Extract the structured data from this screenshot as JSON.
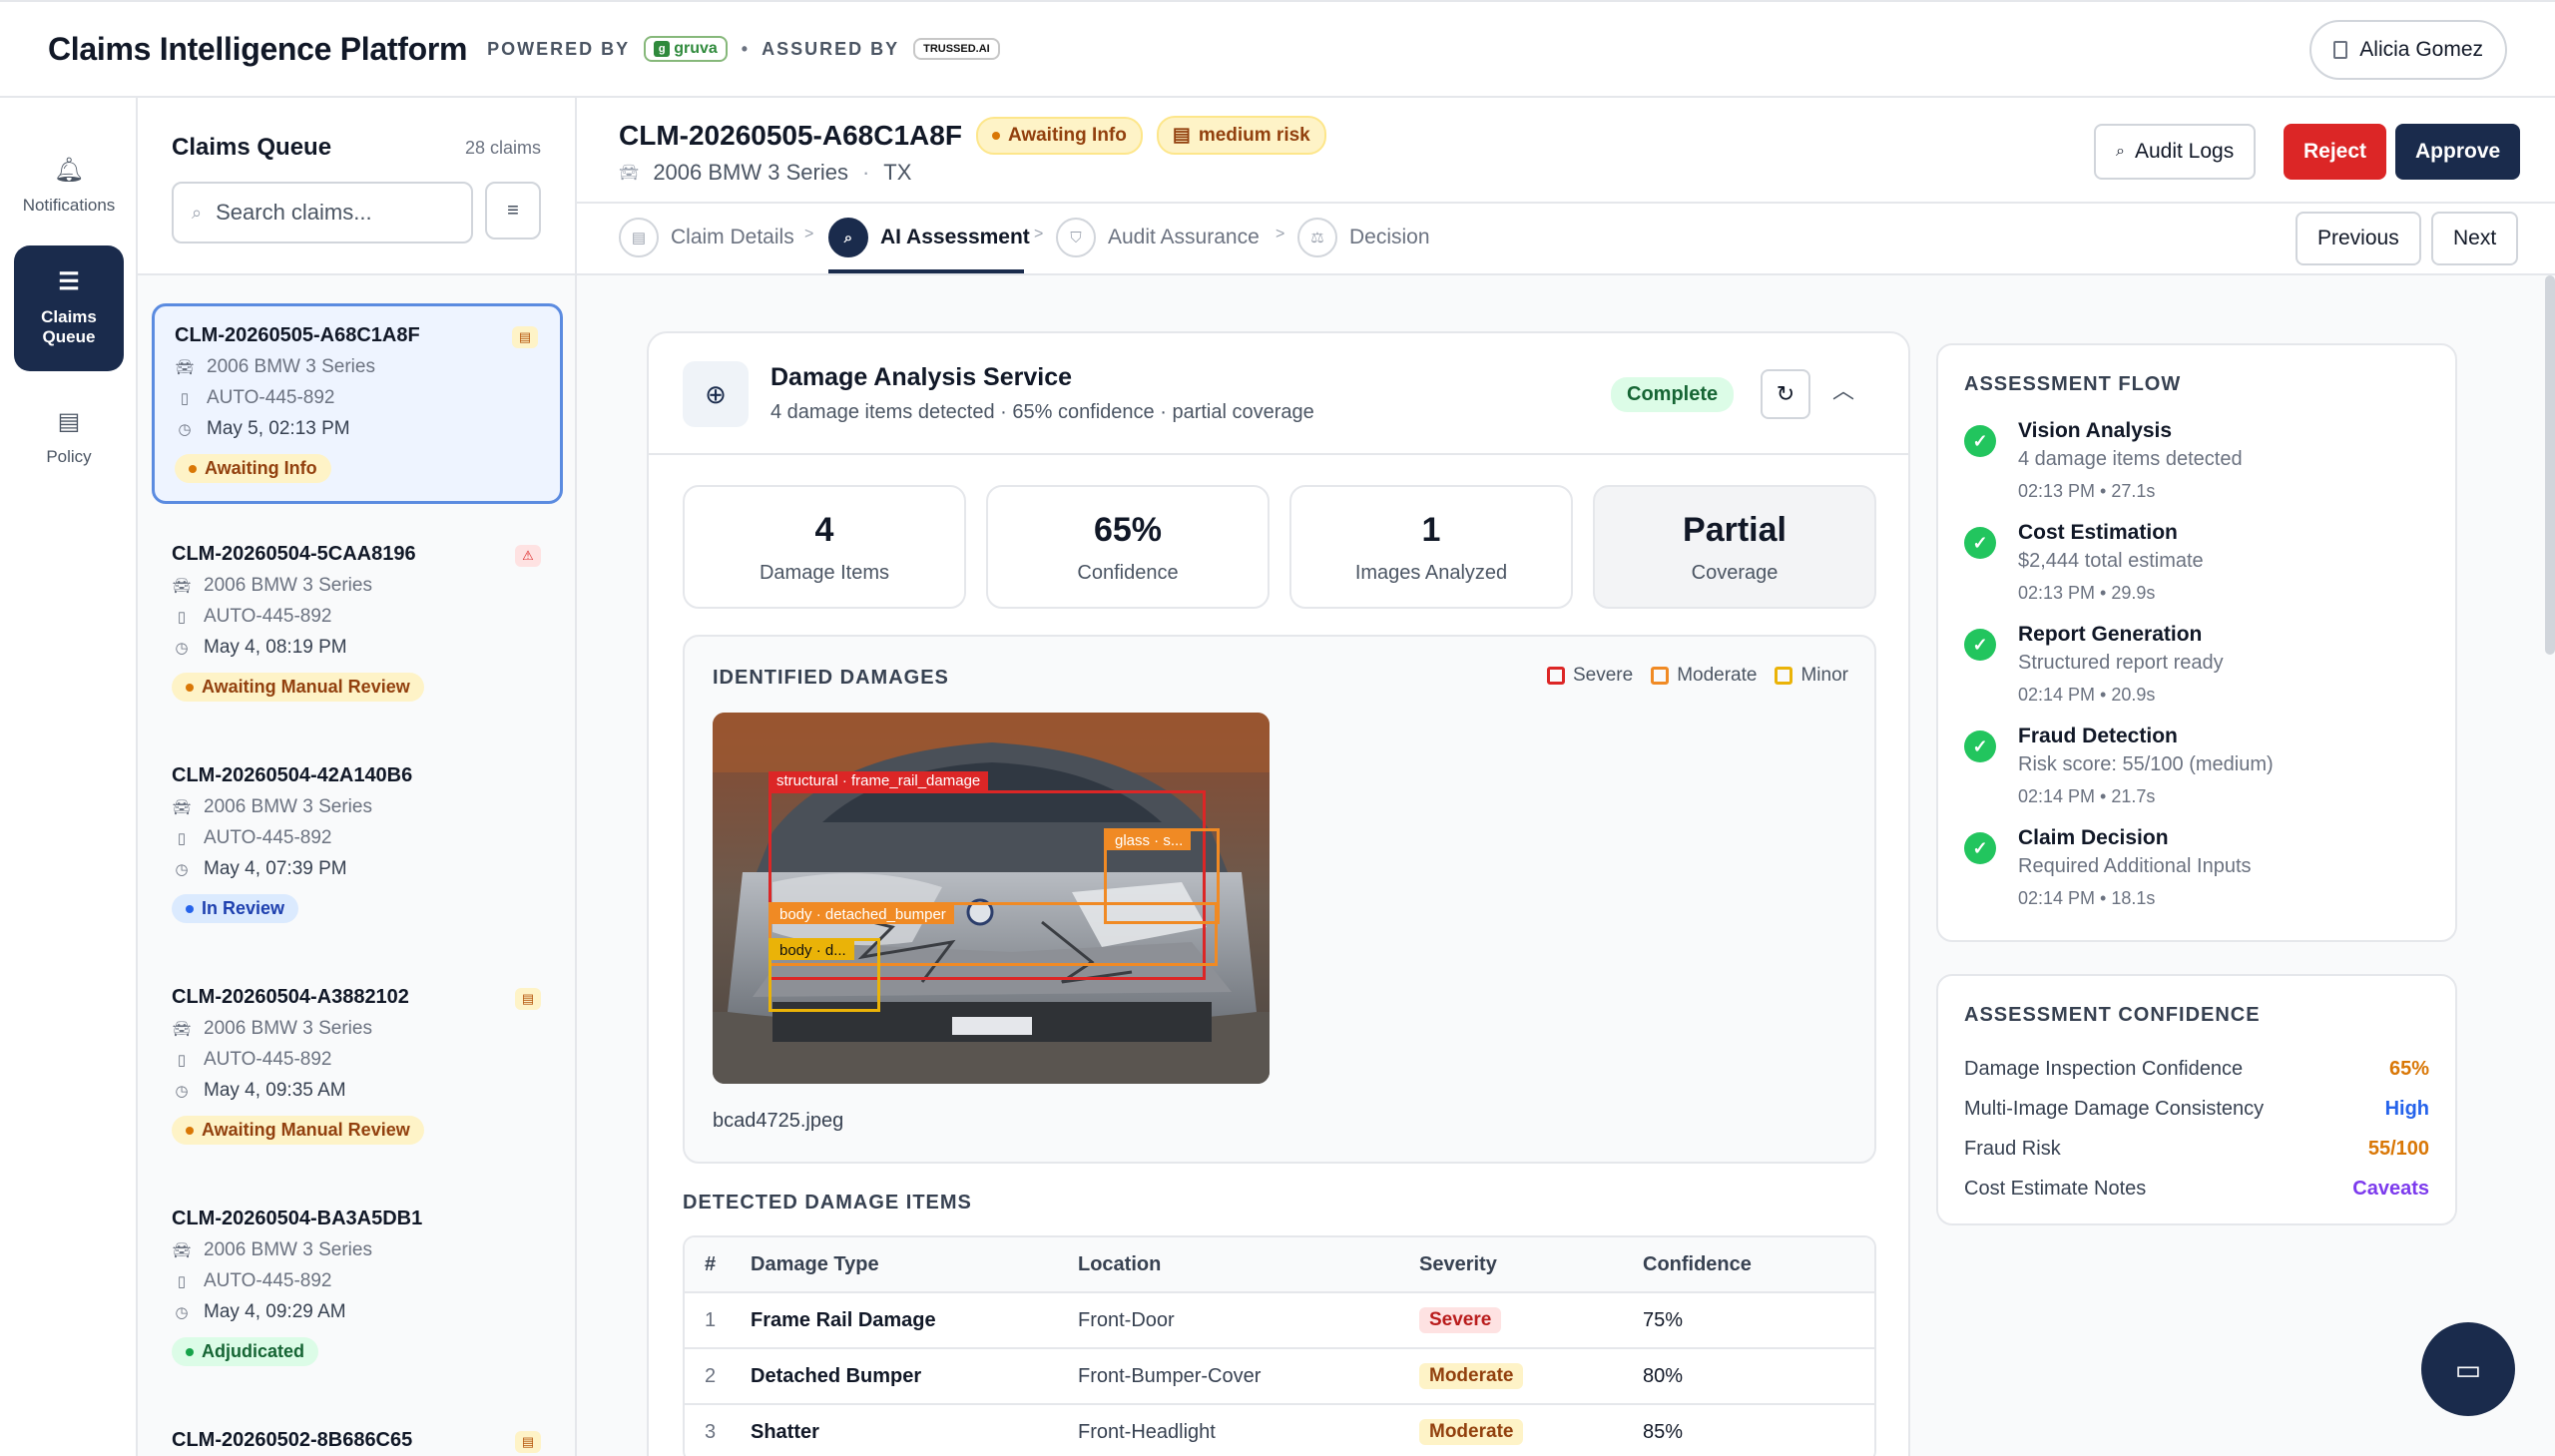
{
  "app": {
    "title": "Claims Intelligence Platform",
    "powered_by": "POWERED BY",
    "gruva": "gruva",
    "dot": "•",
    "assured_by": "ASSURED BY",
    "trussed": "TRUSSED.AI",
    "user_name": "Alicia Gomez"
  },
  "nav": {
    "notifications": "Notifications",
    "claims_queue": "Claims Queue",
    "policy": "Policy"
  },
  "queue": {
    "title": "Claims Queue",
    "count": "28 claims",
    "search_placeholder": "Search claims...",
    "claims": [
      {
        "id": "CLM-20260505-A68C1A8F",
        "vehicle": "2006 BMW 3 Series",
        "policy": "AUTO-445-892",
        "date": "May 5, 02:13 PM",
        "status": "Awaiting Info",
        "flag": "document"
      },
      {
        "id": "CLM-20260504-5CAA8196",
        "vehicle": "2006 BMW 3 Series",
        "policy": "AUTO-445-892",
        "date": "May 4, 08:19 PM",
        "status": "Awaiting Manual Review",
        "flag": "alert"
      },
      {
        "id": "CLM-20260504-42A140B6",
        "vehicle": "2006 BMW 3 Series",
        "policy": "AUTO-445-892",
        "date": "May 4, 07:39 PM",
        "status": "In Review",
        "flag": ""
      },
      {
        "id": "CLM-20260504-A3882102",
        "vehicle": "2006 BMW 3 Series",
        "policy": "AUTO-445-892",
        "date": "May 4, 09:35 AM",
        "status": "Awaiting Manual Review",
        "flag": "document"
      },
      {
        "id": "CLM-20260504-BA3A5DB1",
        "vehicle": "2006 BMW 3 Series",
        "policy": "AUTO-445-892",
        "date": "May 4, 09:29 AM",
        "status": "Adjudicated",
        "flag": ""
      },
      {
        "id": "CLM-20260502-8B686C65",
        "vehicle": "",
        "policy": "",
        "date": "",
        "status": "",
        "flag": "document"
      }
    ]
  },
  "claim": {
    "id": "CLM-20260505-A68C1A8F",
    "status": "Awaiting Info",
    "risk": "medium risk",
    "vehicle": "2006 BMW 3 Series",
    "sep": "·",
    "state": "TX",
    "audit_logs": "Audit Logs",
    "reject": "Reject",
    "approve": "Approve",
    "previous": "Previous",
    "next": "Next",
    "steps": [
      "Claim Details",
      "AI Assessment",
      "Audit Assurance",
      "Decision"
    ]
  },
  "service": {
    "title": "Damage Analysis Service",
    "subtitle": "4 damage items detected · 65% confidence · partial coverage",
    "status": "Complete",
    "stats": [
      {
        "value": "4",
        "label": "Damage Items"
      },
      {
        "value": "65%",
        "label": "Confidence"
      },
      {
        "value": "1",
        "label": "Images Analyzed"
      },
      {
        "value": "Partial",
        "label": "Coverage"
      }
    ],
    "identified_label": "IDENTIFIED DAMAGES",
    "legend": [
      "Severe",
      "Moderate",
      "Minor"
    ],
    "boxes": [
      {
        "label": "structural · frame_rail_damage",
        "severity": "severe"
      },
      {
        "label": "glass · s...",
        "severity": "moderate"
      },
      {
        "label": "body · detached_bumper",
        "severity": "moderate"
      },
      {
        "label": "body · d...",
        "severity": "minor"
      }
    ],
    "filename": "bcad4725.jpeg",
    "detected_label": "DETECTED DAMAGE ITEMS",
    "table_headers": [
      "#",
      "Damage Type",
      "Location",
      "Severity",
      "Confidence"
    ],
    "rows": [
      {
        "n": "1",
        "type": "Frame Rail Damage",
        "location": "Front-Door",
        "severity": "Severe",
        "confidence": "75%"
      },
      {
        "n": "2",
        "type": "Detached Bumper",
        "location": "Front-Bumper-Cover",
        "severity": "Moderate",
        "confidence": "80%"
      },
      {
        "n": "3",
        "type": "Shatter",
        "location": "Front-Headlight",
        "severity": "Moderate",
        "confidence": "85%"
      }
    ]
  },
  "flow": {
    "title": "ASSESSMENT FLOW",
    "items": [
      {
        "title": "Vision Analysis",
        "desc": "4 damage items detected",
        "meta": "02:13 PM • 27.1s"
      },
      {
        "title": "Cost Estimation",
        "desc": "$2,444 total estimate",
        "meta": "02:13 PM • 29.9s"
      },
      {
        "title": "Report Generation",
        "desc": "Structured report ready",
        "meta": "02:14 PM • 20.9s"
      },
      {
        "title": "Fraud Detection",
        "desc": "Risk score: 55/100 (medium)",
        "meta": "02:14 PM • 21.7s"
      },
      {
        "title": "Claim Decision",
        "desc": "Required Additional Inputs",
        "meta": "02:14 PM • 18.1s"
      }
    ]
  },
  "confidence": {
    "title": "ASSESSMENT CONFIDENCE",
    "rows": [
      {
        "label": "Damage Inspection Confidence",
        "value": "65%",
        "color": "#d97706"
      },
      {
        "label": "Multi-Image Damage Consistency",
        "value": "High",
        "color": "#2563eb"
      },
      {
        "label": "Fraud Risk",
        "value": "55/100",
        "color": "#d97706"
      },
      {
        "label": "Cost Estimate Notes",
        "value": "Caveats",
        "color": "#7c3aed"
      }
    ]
  },
  "colors": {
    "navy": "#1a2b4c",
    "severe": "#dc2626",
    "moderate": "#f08a24",
    "minor": "#eab308"
  }
}
